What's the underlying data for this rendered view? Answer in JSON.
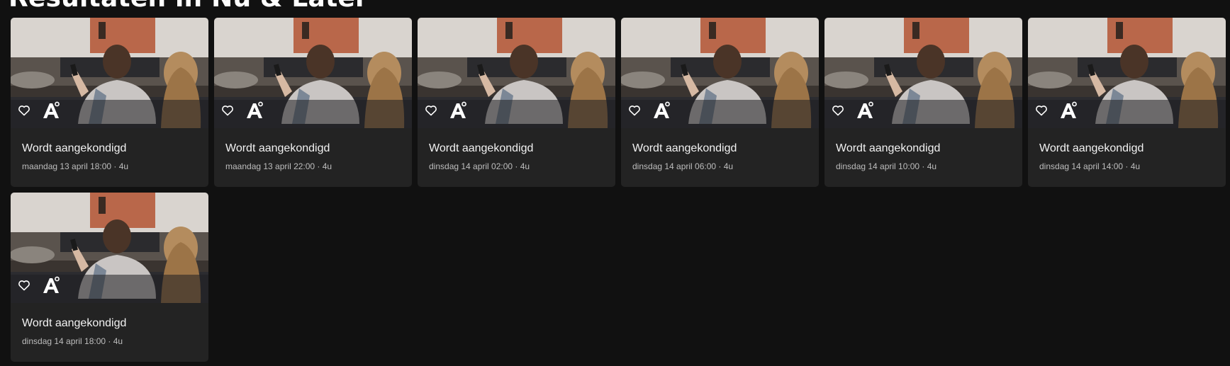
{
  "section": {
    "title": "Resultaten in Nu & Later"
  },
  "cards": [
    {
      "title": "Wordt aangekondigd",
      "meta": "maandag 13 april 18:00 · 4u",
      "channel_icon": "channel-a-logo",
      "favorite_icon": "heart-outline-icon"
    },
    {
      "title": "Wordt aangekondigd",
      "meta": "maandag 13 april 22:00 · 4u",
      "channel_icon": "channel-a-logo",
      "favorite_icon": "heart-outline-icon"
    },
    {
      "title": "Wordt aangekondigd",
      "meta": "dinsdag 14 april 02:00 · 4u",
      "channel_icon": "channel-a-logo",
      "favorite_icon": "heart-outline-icon"
    },
    {
      "title": "Wordt aangekondigd",
      "meta": "dinsdag 14 april 06:00 · 4u",
      "channel_icon": "channel-a-logo",
      "favorite_icon": "heart-outline-icon"
    },
    {
      "title": "Wordt aangekondigd",
      "meta": "dinsdag 14 april 10:00 · 4u",
      "channel_icon": "channel-a-logo",
      "favorite_icon": "heart-outline-icon"
    },
    {
      "title": "Wordt aangekondigd",
      "meta": "dinsdag 14 april 14:00 · 4u",
      "channel_icon": "channel-a-logo",
      "favorite_icon": "heart-outline-icon"
    },
    {
      "title": "Wordt aangekondigd",
      "meta": "dinsdag 14 april 18:00 · 4u",
      "channel_icon": "channel-a-logo",
      "favorite_icon": "heart-outline-icon"
    }
  ],
  "colors": {
    "background": "#111111",
    "card": "#232323",
    "text": "#f2f2f2",
    "meta_text": "#bdbdbd"
  }
}
